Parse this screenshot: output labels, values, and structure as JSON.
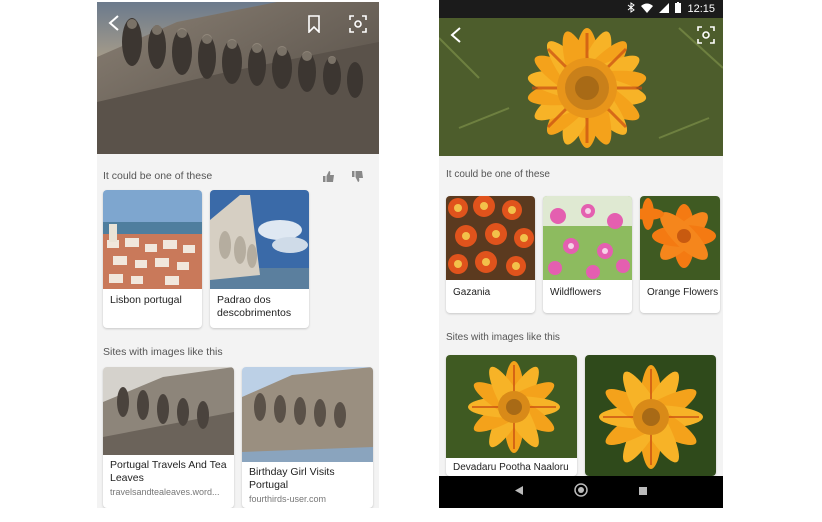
{
  "left": {
    "icons": [
      "back-arrow-icon",
      "bookmark-icon",
      "visual-search-icon",
      "thumbs-up-icon",
      "thumbs-down-icon"
    ],
    "section1_title": "It could be one of these",
    "suggestions": [
      {
        "label": "Lisbon portugal"
      },
      {
        "label": "Padrao dos descobrimentos"
      }
    ],
    "section2_title": "Sites with images like this",
    "sites": [
      {
        "title": "Portugal Travels And Tea Leaves",
        "source": "travelsandtealeaves.word..."
      },
      {
        "title": "Birthday Girl Visits Portugal",
        "source": "fourthirds-user.com"
      }
    ]
  },
  "right": {
    "status_time": "12:15",
    "icons": [
      "back-arrow-icon",
      "visual-search-icon",
      "bluetooth-icon",
      "wifi-icon",
      "signal-icon",
      "battery-icon",
      "nav-back-icon",
      "nav-home-icon",
      "nav-recents-icon"
    ],
    "section1_title": "It could be one of these",
    "suggestions": [
      {
        "label": "Gazania"
      },
      {
        "label": "Wildflowers"
      },
      {
        "label": "Orange Flowers"
      }
    ],
    "section2_title": "Sites with images like this",
    "sites": [
      {
        "title": "Devadaru Pootha Naaloru"
      },
      {
        "title": ""
      }
    ]
  }
}
